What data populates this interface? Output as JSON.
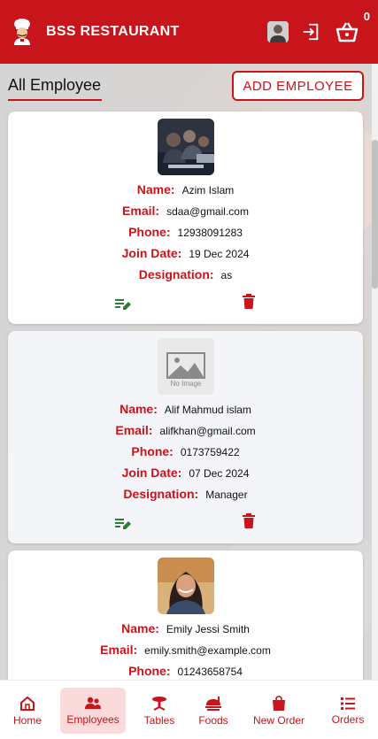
{
  "app": {
    "title": "BSS RESTAURANT",
    "cart_count": "0"
  },
  "header_icons": [
    "chef-logo-icon",
    "user-avatar",
    "logout-icon",
    "cart-icon"
  ],
  "page": {
    "title": "All Employee",
    "add_button": "ADD EMPLOYEE"
  },
  "labels": {
    "name": "Name:",
    "email": "Email:",
    "phone": "Phone:",
    "join_date": "Join Date:",
    "designation": "Designation:"
  },
  "employees": [
    {
      "name": "Azim Islam",
      "email": "sdaa@gmail.com",
      "phone": "12938091283",
      "join_date": "19 Dec 2024",
      "designation": "as",
      "photo": "group-photo"
    },
    {
      "name": "Alif Mahmud islam",
      "email": "alifkhan@gmail.com",
      "phone": "0173759422",
      "join_date": "07 Dec 2024",
      "designation": "Manager",
      "photo": "no-image",
      "no_image_text": "No Image"
    },
    {
      "name": "Emily Jessi Smith",
      "email": "emily.smith@example.com",
      "phone": "01243658754",
      "photo": "portrait"
    }
  ],
  "nav": [
    {
      "label": "Home",
      "icon": "home-icon"
    },
    {
      "label": "Employees",
      "icon": "employees-icon",
      "active": true
    },
    {
      "label": "Tables",
      "icon": "table-icon"
    },
    {
      "label": "Foods",
      "icon": "foods-icon"
    },
    {
      "label": "New Order",
      "icon": "shopping-bag-icon"
    },
    {
      "label": "Orders",
      "icon": "list-icon"
    }
  ],
  "colors": {
    "brand_red": "#c8141b",
    "edit_green": "#2e7d32",
    "active_nav_bg": "#fbdadb"
  }
}
